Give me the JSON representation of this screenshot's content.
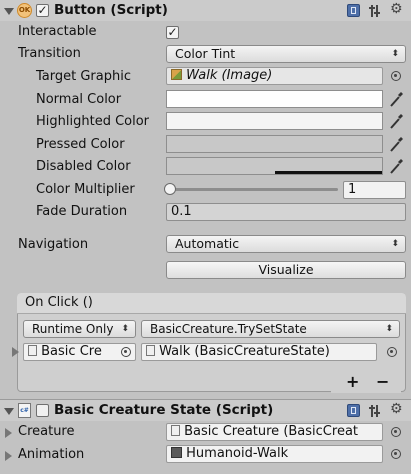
{
  "button_component": {
    "title": "Button (Script)",
    "enabled": true,
    "fields": {
      "interactable_label": "Interactable",
      "interactable_checked": true,
      "transition_label": "Transition",
      "transition_value": "Color Tint",
      "target_graphic_label": "Target Graphic",
      "target_graphic_value": "Walk (Image)",
      "normal_color_label": "Normal Color",
      "highlighted_color_label": "Highlighted Color",
      "pressed_color_label": "Pressed Color",
      "disabled_color_label": "Disabled Color",
      "color_multiplier_label": "Color Multiplier",
      "color_multiplier_value": "1",
      "fade_duration_label": "Fade Duration",
      "fade_duration_value": "0.1",
      "navigation_label": "Navigation",
      "navigation_value": "Automatic",
      "visualize_label": "Visualize"
    },
    "colors": {
      "normal": "#ffffff",
      "highlighted": "#f5f5f5",
      "pressed": "#c8c8c8",
      "disabled": "#c8c8c8"
    },
    "color_multiplier_fraction": 0.0
  },
  "on_click": {
    "header": "On Click ()",
    "runtime_value": "Runtime Only",
    "function_value": "BasicCreature.TrySetState",
    "object_value": "Basic Cre",
    "argument_value": "Walk (BasicCreatureState)",
    "add_label": "+",
    "remove_label": "−"
  },
  "state_component": {
    "title": "Basic Creature State (Script)",
    "enabled": false,
    "creature_label": "Creature",
    "creature_value": "Basic Creature (BasicCreat",
    "animation_label": "Animation",
    "animation_value": "Humanoid-Walk"
  },
  "icons": {
    "ok_badge": "OK",
    "script_badge": "c#",
    "dropdown_arrow": "⬍"
  }
}
